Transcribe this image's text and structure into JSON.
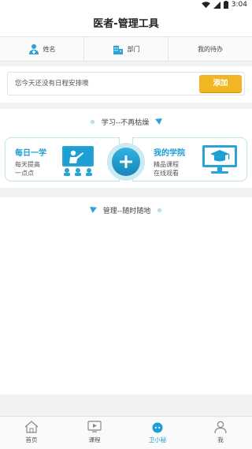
{
  "status_bar": {
    "time": "3:04",
    "icons": [
      "wifi-icon",
      "signal-icon",
      "battery-icon"
    ]
  },
  "app_bar": {
    "title": "医者-管理工具"
  },
  "user_row": {
    "name_label": "姓名",
    "dept_label": "部门",
    "todo_label": "我的待办"
  },
  "schedule": {
    "placeholder": "您今天还没有日程安排噢",
    "add_label": "添加"
  },
  "learn": {
    "title": "学习--不再枯燥",
    "daily": {
      "title": "每日一学",
      "line1": "每天提高",
      "line2": "一点点"
    },
    "academy": {
      "title": "我的学院",
      "line1": "精品课程",
      "line2": "在线观看"
    }
  },
  "manage": {
    "title": "管理--随时随地"
  },
  "tabs": [
    {
      "label": "首页",
      "icon": "home-icon",
      "active": false
    },
    {
      "label": "课程",
      "icon": "course-icon",
      "active": false
    },
    {
      "label": "卫小秘",
      "icon": "assistant-icon",
      "active": true
    },
    {
      "label": "我",
      "icon": "profile-icon",
      "active": false
    }
  ],
  "colors": {
    "accent": "#1c9fd3",
    "add_button": "#f2b623",
    "background": "#f2f2f2"
  }
}
